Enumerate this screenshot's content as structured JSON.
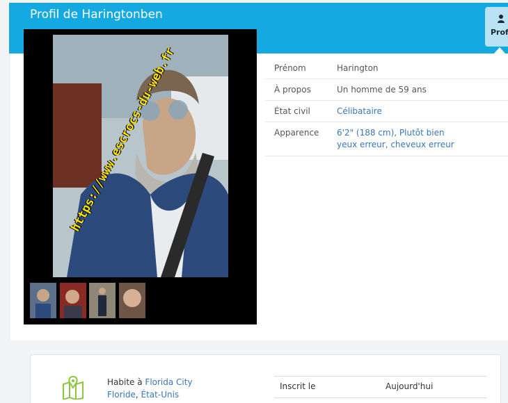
{
  "profile": {
    "title": "Profil de Haringtonben",
    "tab_label": "Prof",
    "tab_icon": "user-icon"
  },
  "photo": {
    "watermark": "https://www.escrocs-du-web.fr",
    "thumbnails": [
      "thumb-1",
      "thumb-2",
      "thumb-3",
      "thumb-4"
    ]
  },
  "details": [
    {
      "label": "Prénom",
      "value": "Harington"
    },
    {
      "label": "À propos",
      "value": "Un homme de 59 ans"
    },
    {
      "label": "État civil",
      "value": "Célibataire"
    },
    {
      "label": "Apparence",
      "value_line1": "6'2\" (188 cm), Plutôt bien",
      "value_line2": "yeux erreur, cheveux erreur"
    }
  ],
  "location": {
    "prefix": "Habite à",
    "city": "Florida City",
    "state": "Floride",
    "separator": ",",
    "country": "État-Unis"
  },
  "registration": {
    "label": "Inscrit le",
    "value": "Aujourd'hui"
  },
  "colors": {
    "header": "#14a9e1",
    "link": "#3a77b6",
    "tab": "#b9e3f4"
  }
}
